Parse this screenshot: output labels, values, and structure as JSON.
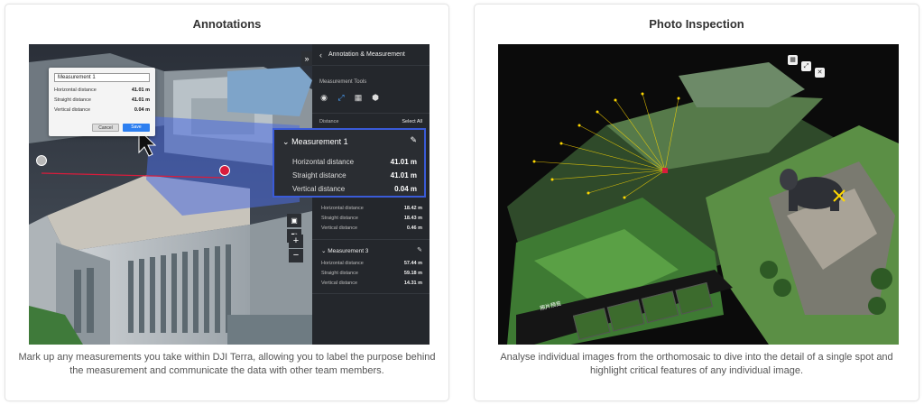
{
  "left_card": {
    "title": "Annotations",
    "description": "Mark up any measurements you take within DJI Terra, allowing you to label the purpose behind the measurement and communicate the data with other team members.",
    "panel": {
      "header": "Annotation & Measurement",
      "tools_label": "Measurement Tools",
      "distance_label": "Distance",
      "select_all": "Select All",
      "measurement2": {
        "rows": [
          {
            "label": "Horizontal distance",
            "value": "18.42 m"
          },
          {
            "label": "Straight distance",
            "value": "18.43 m"
          },
          {
            "label": "Vertical distance",
            "value": "0.46 m"
          }
        ]
      },
      "measurement3": {
        "title": "Measurement 3",
        "rows": [
          {
            "label": "Horizontal distance",
            "value": "57.44 m"
          },
          {
            "label": "Straight distance",
            "value": "59.18 m"
          },
          {
            "label": "Vertical distance",
            "value": "14.31 m"
          }
        ]
      }
    },
    "dialog": {
      "name_value": "Measurement 1",
      "rows": [
        {
          "label": "Horizontal distance",
          "value": "41.01 m"
        },
        {
          "label": "Straight distance",
          "value": "41.01 m"
        },
        {
          "label": "Vertical distance",
          "value": "0.04 m"
        }
      ],
      "cancel": "Cancel",
      "save": "Save"
    },
    "popup": {
      "title": "Measurement 1",
      "rows": [
        {
          "label": "Horizontal distance",
          "value": "41.01 m"
        },
        {
          "label": "Straight distance",
          "value": "41.01 m"
        },
        {
          "label": "Vertical distance",
          "value": "0.04 m"
        }
      ]
    },
    "controls": {
      "expand": "»",
      "zoom_in": "+",
      "zoom_out": "−"
    },
    "colors": {
      "accent": "#3a5bd8",
      "panel_bg": "#24272c",
      "save_button": "#2d7ff0",
      "measure_point": "#d91c3c"
    }
  },
  "right_card": {
    "title": "Photo Inspection",
    "description": "Analyse individual images from the orthomosaic to dive into the detail of a single spot and highlight critical features of any individual image.",
    "strip_label": "照片预览",
    "colors": {
      "marker": "#ffd800"
    }
  }
}
